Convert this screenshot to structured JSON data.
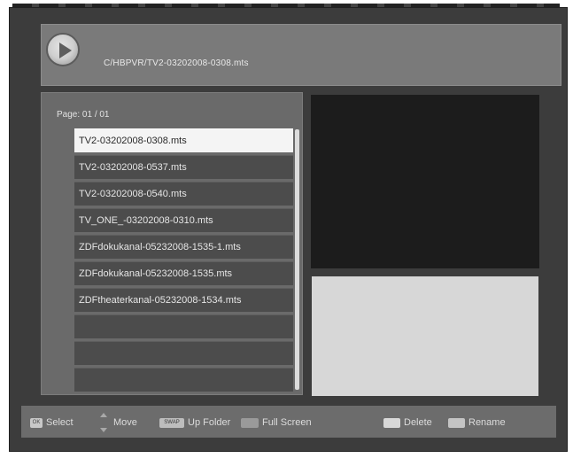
{
  "header": {
    "path": "C/HBPVR/TV2-03202008-0308.mts"
  },
  "page": {
    "label": "Page: 01 / 01"
  },
  "files": [
    "TV2-03202008-0308.mts",
    "TV2-03202008-0537.mts",
    "TV2-03202008-0540.mts",
    "TV_ONE_-03202008-0310.mts",
    "ZDFdokukanal-05232008-1535-1.mts",
    "ZDFdokukanal-05232008-1535.mts",
    "ZDFtheaterkanal-05232008-1534.mts",
    "",
    "",
    ""
  ],
  "selected_index": 0,
  "footer": {
    "ok_key": "OK",
    "select": "Select",
    "move": "Move",
    "swap_key": "SWAP",
    "up_folder": "Up Folder",
    "full_screen": "Full Screen",
    "delete": "Delete",
    "rename": "Rename"
  },
  "icons": {
    "play": "play-icon",
    "move_arrows": "up-down-arrow-icon"
  }
}
